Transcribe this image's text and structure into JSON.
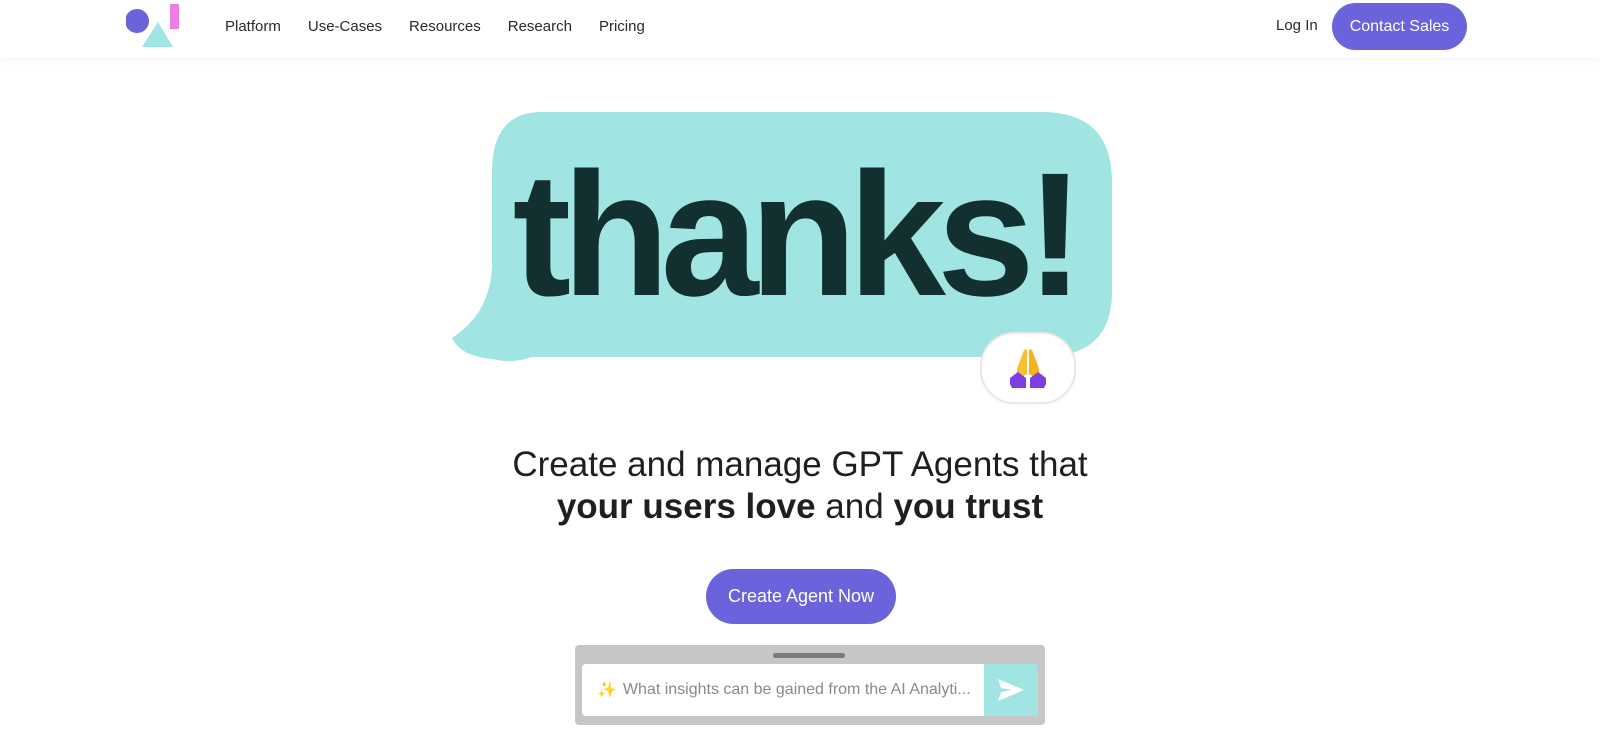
{
  "nav": {
    "items": [
      {
        "label": "Platform"
      },
      {
        "label": "Use-Cases"
      },
      {
        "label": "Resources"
      },
      {
        "label": "Research"
      },
      {
        "label": "Pricing"
      }
    ],
    "login_label": "Log In",
    "contact_label": "Contact Sales"
  },
  "hero": {
    "bubble_text": "thanks!",
    "emoji_icon": "folded-hands-icon",
    "headline_line1": "Create and manage GPT Agents that",
    "headline_bold1": "your users love",
    "headline_mid": "and",
    "headline_bold2": "you trust",
    "cta_label": "Create Agent Now"
  },
  "chat_widget": {
    "sparkle_icon": "sparkles-icon",
    "placeholder": "What insights can be gained from the AI Analyti...",
    "send_icon": "send-arrow-icon"
  },
  "colors": {
    "accent": "#6a63dc",
    "bubble": "#a0e5e2",
    "bubble_text": "#11302f",
    "logo_circle": "#6a63dc",
    "logo_triangle": "#a0e5e2",
    "logo_bar": "#ec7ee4"
  }
}
